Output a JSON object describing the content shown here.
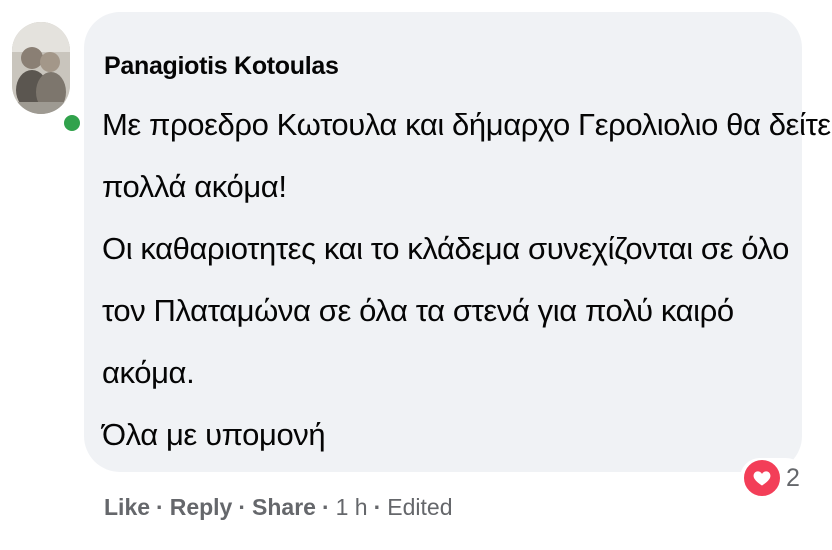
{
  "comment": {
    "author": "Panagiotis Kotoulas",
    "lines": [
      "Με προεδρο Κωτουλα και δήμαρχο Γερολιολιο θα δείτε",
      "πολλά ακόμα!",
      "Οι καθαριοτητες και το κλάδεμα συνεχίζονται σε όλο",
      "τον Πλαταμώνα σε όλα τα στενά για πολύ καιρό",
      "ακόμα.",
      "Όλα με υπομονή"
    ],
    "author_online": true
  },
  "reactions": {
    "icon": "love-icon",
    "count": "2",
    "color": "#f33e58"
  },
  "actions": {
    "like": "Like",
    "reply": "Reply",
    "share": "Share",
    "separator": "·",
    "time": "1 h",
    "edited": "Edited"
  },
  "colors": {
    "bubble": "#f0f2f5",
    "online": "#31a24c",
    "secondary_text": "#65676b",
    "primary_text": "#050505"
  }
}
